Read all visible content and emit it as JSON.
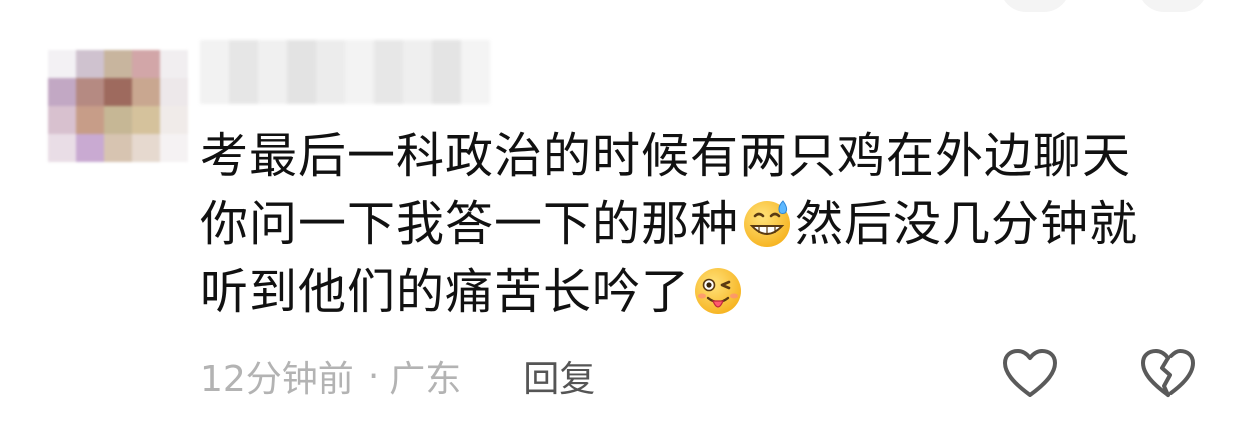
{
  "comment": {
    "text_lines": [
      [
        "考最后一科政治的时候有两只鸡在外边聊天"
      ],
      [
        "你问一下我答一下的那种",
        "然后没几分钟就"
      ],
      [
        "听到他们的痛苦长吟了"
      ]
    ],
    "emojis": [
      "sweat-smile-emoji",
      "winking-tongue-emoji"
    ]
  },
  "meta": {
    "time": "12分钟前",
    "separator": "·",
    "location": "广东",
    "reply_label": "回复"
  },
  "actions": {
    "like_icon": "heart-outline-icon",
    "dislike_icon": "broken-heart-outline-icon"
  },
  "colors": {
    "text": "#111111",
    "meta": "#b3b3b3",
    "reply": "#555555",
    "icon": "#5a5a5a"
  }
}
